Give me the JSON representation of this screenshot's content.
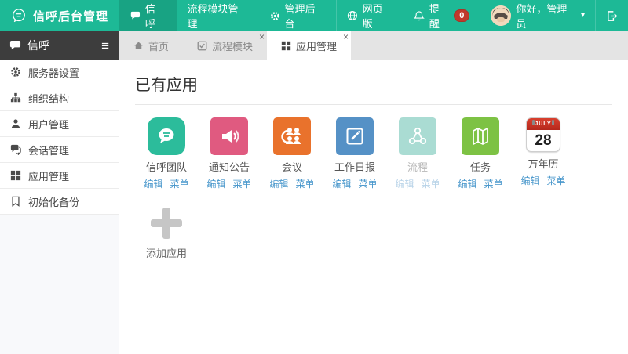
{
  "ui": {
    "close_glyph": "×",
    "menu_glyph": "≡",
    "caret_glyph": "▾"
  },
  "colors": {
    "topbar": "#1db996",
    "topbar_active": "#18a383",
    "sidebar_header": "#3d3d3d",
    "badge": "#c0392b",
    "link": "#4796cb"
  },
  "topbar": {
    "brand": "信呼后台管理",
    "nav": [
      {
        "label": "信呼",
        "icon": "chat-icon",
        "active": true
      },
      {
        "label": "流程模块管理",
        "icon": null,
        "active": false
      },
      {
        "label": "管理后台",
        "icon": "gear-icon",
        "active": false
      }
    ],
    "right": {
      "webpage": "网页版",
      "notify": "提醒",
      "notify_count": "0",
      "greeting": "你好，管理员"
    }
  },
  "sidebar": {
    "title": "信呼",
    "items": [
      {
        "label": "服务器设置",
        "icon": "gear-icon"
      },
      {
        "label": "组织结构",
        "icon": "sitemap-icon"
      },
      {
        "label": "用户管理",
        "icon": "user-icon"
      },
      {
        "label": "会话管理",
        "icon": "comments-icon"
      },
      {
        "label": "应用管理",
        "icon": "grid-icon"
      },
      {
        "label": "初始化备份",
        "icon": "bookmark-icon"
      }
    ]
  },
  "tabs": [
    {
      "label": "首页",
      "icon": "home-icon",
      "active": false,
      "closable": false
    },
    {
      "label": "流程模块",
      "icon": "check-square-icon",
      "active": false,
      "closable": true
    },
    {
      "label": "应用管理",
      "icon": "grid-icon",
      "active": true,
      "closable": true
    }
  ],
  "main": {
    "heading": "已有应用",
    "add_label": "添加应用",
    "apps": [
      {
        "name": "信呼团队",
        "icon": "chat-bubble",
        "color": "#2cbc9b",
        "edit": "编辑",
        "menu": "菜单",
        "disabled": false
      },
      {
        "name": "通知公告",
        "icon": "speaker",
        "color": "#e05a80",
        "edit": "编辑",
        "menu": "菜单",
        "disabled": false
      },
      {
        "name": "会议",
        "icon": "users-group",
        "color": "#e9722c",
        "edit": "编辑",
        "menu": "菜单",
        "disabled": false
      },
      {
        "name": "工作日报",
        "icon": "edit-square",
        "color": "#5591c6",
        "edit": "编辑",
        "menu": "菜单",
        "disabled": false
      },
      {
        "name": "流程",
        "icon": "share-nodes",
        "color": "#aadcd3",
        "edit": "编辑",
        "menu": "菜单",
        "disabled": true
      },
      {
        "name": "任务",
        "icon": "folded-map",
        "color": "#7dc244",
        "edit": "编辑",
        "menu": "菜单",
        "disabled": false
      },
      {
        "name": "万年历",
        "icon": "calendar",
        "color": "#ffffff",
        "month": "JULY",
        "day": "28",
        "edit": "编辑",
        "menu": "菜单",
        "disabled": false
      }
    ]
  }
}
